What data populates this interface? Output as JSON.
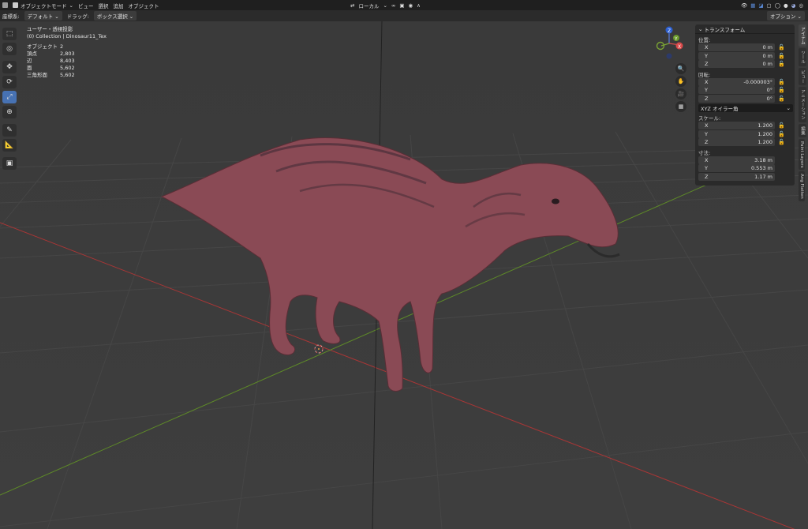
{
  "header": {
    "mode": "オブジェクトモード",
    "menus": [
      "ビュー",
      "選択",
      "追加",
      "オブジェクト"
    ],
    "transform_orientation": "ローカル"
  },
  "tool_settings": {
    "orientation_label": "座標系:",
    "orientation_value": "デフォルト",
    "drag_label": "ドラッグ:",
    "drag_value": "ボックス選択",
    "options_label": "オプション"
  },
  "overlay": {
    "view_name": "ユーザー・透視投影",
    "collection": "(0) Collection | Dinosaur11_Tex",
    "stats": [
      {
        "label": "オブジェクト",
        "value": "2"
      },
      {
        "label": "頂点",
        "value": "2,803"
      },
      {
        "label": "辺",
        "value": "8,403"
      },
      {
        "label": "面",
        "value": "5,602"
      },
      {
        "label": "三角形面",
        "value": "5,602"
      }
    ]
  },
  "tools": [
    "select-box",
    "cursor",
    "move",
    "rotate",
    "scale",
    "transform",
    "annotate",
    "measure",
    "add-cube"
  ],
  "gizmo": {
    "z": "Z",
    "y": "Y",
    "x": "X"
  },
  "npanel": {
    "title": "トランスフォーム",
    "location_label": "位置:",
    "location": [
      {
        "axis": "X",
        "value": "0 m"
      },
      {
        "axis": "Y",
        "value": "0 m"
      },
      {
        "axis": "Z",
        "value": "0 m"
      }
    ],
    "rotation_label": "回転:",
    "rotation": [
      {
        "axis": "X",
        "value": "-0.000003°"
      },
      {
        "axis": "Y",
        "value": "0°"
      },
      {
        "axis": "Z",
        "value": "0°"
      }
    ],
    "rotation_mode": "XYZ オイラー角",
    "scale_label": "スケール:",
    "scale": [
      {
        "axis": "X",
        "value": "1.200"
      },
      {
        "axis": "Y",
        "value": "1.200"
      },
      {
        "axis": "Z",
        "value": "1.200"
      }
    ],
    "dimensions_label": "寸法:",
    "dimensions": [
      {
        "axis": "X",
        "value": "3.18 m"
      },
      {
        "axis": "Y",
        "value": "0.553 m"
      },
      {
        "axis": "Z",
        "value": "1.17 m"
      }
    ]
  },
  "side_tabs": [
    "アイテム",
    "ツール",
    "ビュー",
    "アニメーション",
    "編集",
    "Paint Layers",
    "Ang Flatten"
  ],
  "colors": {
    "accent": "#4772b3",
    "x_axis": "#c23a3a",
    "y_axis": "#6a9a2a",
    "dino": "#8a4a55"
  }
}
